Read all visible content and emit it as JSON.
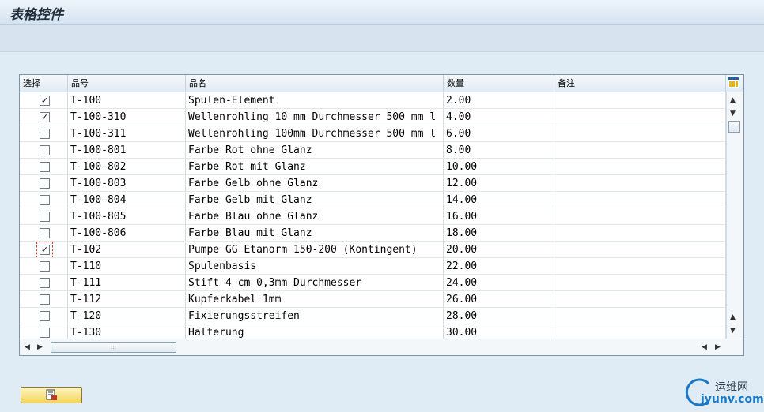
{
  "window": {
    "title": "表格控件"
  },
  "table": {
    "columns": [
      "选择",
      "品号",
      "品名",
      "数量",
      "备注"
    ],
    "rows": [
      {
        "selected": true,
        "code": "T-100",
        "name": "Spulen-Element",
        "qty": "2.00",
        "note": ""
      },
      {
        "selected": true,
        "code": "T-100-310",
        "name": "Wellenrohling 10 mm Durchmesser 500 mm l",
        "qty": "4.00",
        "note": ""
      },
      {
        "selected": false,
        "code": "T-100-311",
        "name": "Wellenrohling 100mm Durchmesser 500 mm l",
        "qty": "6.00",
        "note": ""
      },
      {
        "selected": false,
        "code": "T-100-801",
        "name": "Farbe Rot  ohne Glanz",
        "qty": "8.00",
        "note": ""
      },
      {
        "selected": false,
        "code": "T-100-802",
        "name": "Farbe Rot  mit Glanz",
        "qty": "10.00",
        "note": ""
      },
      {
        "selected": false,
        "code": "T-100-803",
        "name": "Farbe Gelb ohne Glanz",
        "qty": "12.00",
        "note": ""
      },
      {
        "selected": false,
        "code": "T-100-804",
        "name": "Farbe Gelb mit Glanz",
        "qty": "14.00",
        "note": ""
      },
      {
        "selected": false,
        "code": "T-100-805",
        "name": "Farbe Blau ohne Glanz",
        "qty": "16.00",
        "note": ""
      },
      {
        "selected": false,
        "code": "T-100-806",
        "name": "Farbe Blau mit Glanz",
        "qty": "18.00",
        "note": ""
      },
      {
        "selected": true,
        "code": "T-102",
        "name": "Pumpe GG Etanorm 150-200 (Kontingent)",
        "qty": "20.00",
        "note": "",
        "focused": true
      },
      {
        "selected": false,
        "code": "T-110",
        "name": "Spulenbasis",
        "qty": "22.00",
        "note": ""
      },
      {
        "selected": false,
        "code": "T-111",
        "name": "Stift 4 cm 0,3mm Durchmesser",
        "qty": "24.00",
        "note": ""
      },
      {
        "selected": false,
        "code": "T-112",
        "name": "Kupferkabel 1mm",
        "qty": "26.00",
        "note": ""
      },
      {
        "selected": false,
        "code": "T-120",
        "name": "Fixierungsstreifen",
        "qty": "28.00",
        "note": ""
      },
      {
        "selected": false,
        "code": "T-130",
        "name": "Halterung",
        "qty": "30.00",
        "note": ""
      }
    ]
  },
  "icons": {
    "layout": "table-layout-icon",
    "button": "exit-icon",
    "scroll_up": "▲",
    "scroll_down": "▼",
    "scroll_left": "◀",
    "scroll_right": "▶",
    "thumb_grip": ":::"
  },
  "watermark": {
    "text_top": "运维网",
    "text_bottom": "iyunv.com"
  },
  "colors": {
    "background": "#dfebf5",
    "button": "#f3d45b",
    "grid_border": "#7f93a8"
  }
}
